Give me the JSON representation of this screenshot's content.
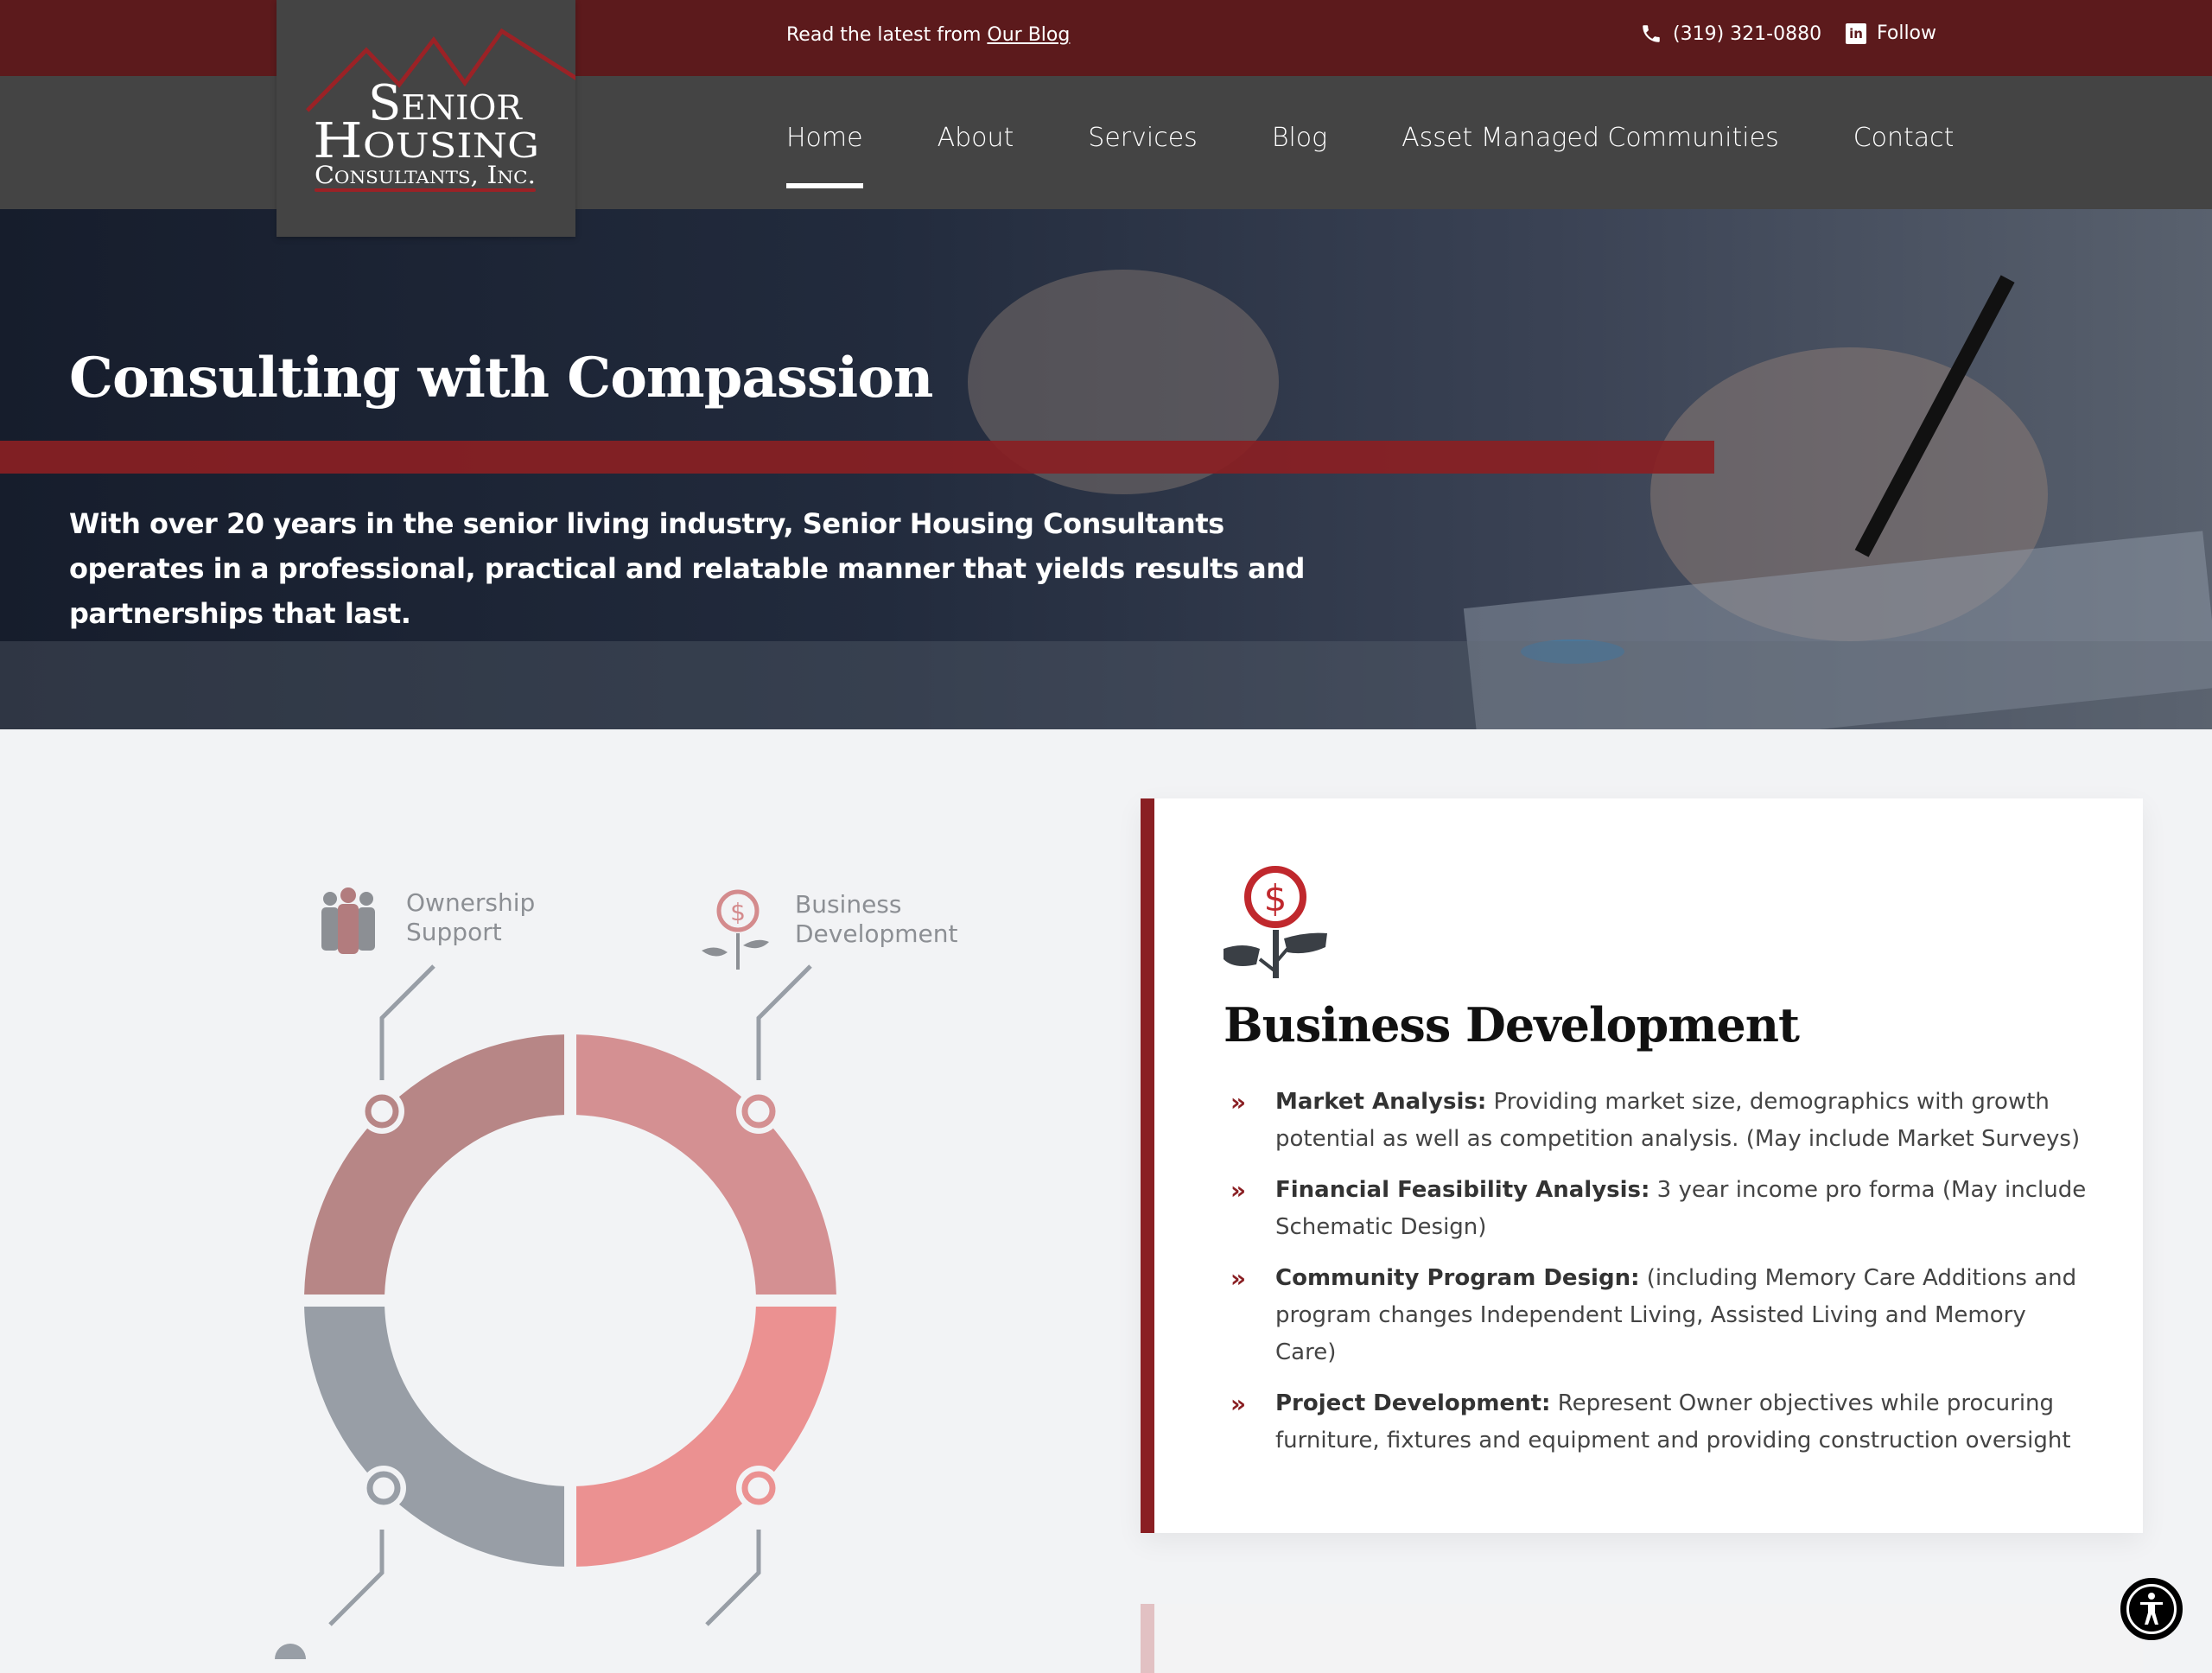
{
  "topbar": {
    "blog_prefix": "Read the latest from ",
    "blog_link": "Our Blog",
    "phone": "(319) 321-0880",
    "follow": "Follow",
    "linkedin_glyph": "in",
    "colors": {
      "background": "#5c1a1c"
    }
  },
  "logo": {
    "line1": "Senior",
    "line2": "Housing",
    "line3": "Consultants, Inc.",
    "accent": "#9b2226"
  },
  "nav": {
    "items": [
      {
        "label": "Home",
        "active": true
      },
      {
        "label": "About",
        "active": false
      },
      {
        "label": "Services",
        "active": false
      },
      {
        "label": "Blog",
        "active": false
      },
      {
        "label": "Asset Managed Communities",
        "active": false
      },
      {
        "label": "Contact",
        "active": false
      }
    ],
    "background": "#444444"
  },
  "hero": {
    "title": "Consulting with Compassion",
    "body": "With over 20 years in the senior living industry, Senior Housing Consultants operates in a professional, practical and relatable manner that yields results and partnerships that last.",
    "accent": "#8a1f23"
  },
  "diagram": {
    "labels": [
      {
        "line1": "Ownership",
        "line2": "Support",
        "icon": "people-icon"
      },
      {
        "line1": "Business",
        "line2": "Development",
        "icon": "money-plant-icon"
      }
    ],
    "segment_colors": [
      "#b78686",
      "#d49092",
      "#eb9191",
      "#989ea6"
    ]
  },
  "card": {
    "title": "Business Development",
    "icon": "money-plant-icon",
    "items": [
      {
        "term": "Market Analysis:",
        "text": " Providing market size, demographics with growth potential as well as competition analysis. (May include Market Surveys)"
      },
      {
        "term": "Financial Feasibility Analysis:",
        "text": " 3 year income pro forma (May include Schematic Design)"
      },
      {
        "term": "Community Program Design:",
        "text": " (including Memory Care Additions and program changes Independent Living, Assisted Living and Memory Care)"
      },
      {
        "term": "Project Development:",
        "text": " Represent Owner objectives while procuring furniture, fixtures and equipment and providing construction oversight"
      }
    ],
    "bullet_glyph": "»"
  },
  "accessibility": {
    "label": "accessibility-icon"
  }
}
